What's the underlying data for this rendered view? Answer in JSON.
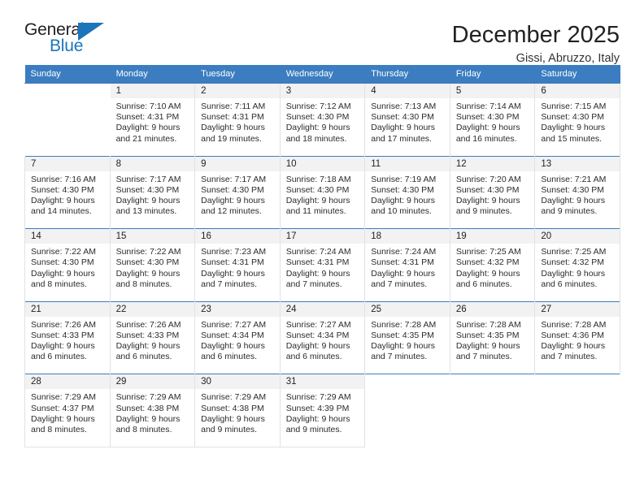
{
  "brand": {
    "name_part1": "General",
    "name_part2": "Blue",
    "accent_color": "#1b75bb"
  },
  "header": {
    "title": "December 2025",
    "subtitle": "Gissi, Abruzzo, Italy"
  },
  "calendar": {
    "header_color": "#3b7dc0",
    "weekday_headers": [
      "Sunday",
      "Monday",
      "Tuesday",
      "Wednesday",
      "Thursday",
      "Friday",
      "Saturday"
    ],
    "weeks": [
      [
        {
          "day": "",
          "sunrise": "",
          "sunset": "",
          "daylight_line1": "",
          "daylight_line2": ""
        },
        {
          "day": "1",
          "sunrise": "Sunrise: 7:10 AM",
          "sunset": "Sunset: 4:31 PM",
          "daylight_line1": "Daylight: 9 hours",
          "daylight_line2": "and 21 minutes."
        },
        {
          "day": "2",
          "sunrise": "Sunrise: 7:11 AM",
          "sunset": "Sunset: 4:31 PM",
          "daylight_line1": "Daylight: 9 hours",
          "daylight_line2": "and 19 minutes."
        },
        {
          "day": "3",
          "sunrise": "Sunrise: 7:12 AM",
          "sunset": "Sunset: 4:30 PM",
          "daylight_line1": "Daylight: 9 hours",
          "daylight_line2": "and 18 minutes."
        },
        {
          "day": "4",
          "sunrise": "Sunrise: 7:13 AM",
          "sunset": "Sunset: 4:30 PM",
          "daylight_line1": "Daylight: 9 hours",
          "daylight_line2": "and 17 minutes."
        },
        {
          "day": "5",
          "sunrise": "Sunrise: 7:14 AM",
          "sunset": "Sunset: 4:30 PM",
          "daylight_line1": "Daylight: 9 hours",
          "daylight_line2": "and 16 minutes."
        },
        {
          "day": "6",
          "sunrise": "Sunrise: 7:15 AM",
          "sunset": "Sunset: 4:30 PM",
          "daylight_line1": "Daylight: 9 hours",
          "daylight_line2": "and 15 minutes."
        }
      ],
      [
        {
          "day": "7",
          "sunrise": "Sunrise: 7:16 AM",
          "sunset": "Sunset: 4:30 PM",
          "daylight_line1": "Daylight: 9 hours",
          "daylight_line2": "and 14 minutes."
        },
        {
          "day": "8",
          "sunrise": "Sunrise: 7:17 AM",
          "sunset": "Sunset: 4:30 PM",
          "daylight_line1": "Daylight: 9 hours",
          "daylight_line2": "and 13 minutes."
        },
        {
          "day": "9",
          "sunrise": "Sunrise: 7:17 AM",
          "sunset": "Sunset: 4:30 PM",
          "daylight_line1": "Daylight: 9 hours",
          "daylight_line2": "and 12 minutes."
        },
        {
          "day": "10",
          "sunrise": "Sunrise: 7:18 AM",
          "sunset": "Sunset: 4:30 PM",
          "daylight_line1": "Daylight: 9 hours",
          "daylight_line2": "and 11 minutes."
        },
        {
          "day": "11",
          "sunrise": "Sunrise: 7:19 AM",
          "sunset": "Sunset: 4:30 PM",
          "daylight_line1": "Daylight: 9 hours",
          "daylight_line2": "and 10 minutes."
        },
        {
          "day": "12",
          "sunrise": "Sunrise: 7:20 AM",
          "sunset": "Sunset: 4:30 PM",
          "daylight_line1": "Daylight: 9 hours",
          "daylight_line2": "and 9 minutes."
        },
        {
          "day": "13",
          "sunrise": "Sunrise: 7:21 AM",
          "sunset": "Sunset: 4:30 PM",
          "daylight_line1": "Daylight: 9 hours",
          "daylight_line2": "and 9 minutes."
        }
      ],
      [
        {
          "day": "14",
          "sunrise": "Sunrise: 7:22 AM",
          "sunset": "Sunset: 4:30 PM",
          "daylight_line1": "Daylight: 9 hours",
          "daylight_line2": "and 8 minutes."
        },
        {
          "day": "15",
          "sunrise": "Sunrise: 7:22 AM",
          "sunset": "Sunset: 4:30 PM",
          "daylight_line1": "Daylight: 9 hours",
          "daylight_line2": "and 8 minutes."
        },
        {
          "day": "16",
          "sunrise": "Sunrise: 7:23 AM",
          "sunset": "Sunset: 4:31 PM",
          "daylight_line1": "Daylight: 9 hours",
          "daylight_line2": "and 7 minutes."
        },
        {
          "day": "17",
          "sunrise": "Sunrise: 7:24 AM",
          "sunset": "Sunset: 4:31 PM",
          "daylight_line1": "Daylight: 9 hours",
          "daylight_line2": "and 7 minutes."
        },
        {
          "day": "18",
          "sunrise": "Sunrise: 7:24 AM",
          "sunset": "Sunset: 4:31 PM",
          "daylight_line1": "Daylight: 9 hours",
          "daylight_line2": "and 7 minutes."
        },
        {
          "day": "19",
          "sunrise": "Sunrise: 7:25 AM",
          "sunset": "Sunset: 4:32 PM",
          "daylight_line1": "Daylight: 9 hours",
          "daylight_line2": "and 6 minutes."
        },
        {
          "day": "20",
          "sunrise": "Sunrise: 7:25 AM",
          "sunset": "Sunset: 4:32 PM",
          "daylight_line1": "Daylight: 9 hours",
          "daylight_line2": "and 6 minutes."
        }
      ],
      [
        {
          "day": "21",
          "sunrise": "Sunrise: 7:26 AM",
          "sunset": "Sunset: 4:33 PM",
          "daylight_line1": "Daylight: 9 hours",
          "daylight_line2": "and 6 minutes."
        },
        {
          "day": "22",
          "sunrise": "Sunrise: 7:26 AM",
          "sunset": "Sunset: 4:33 PM",
          "daylight_line1": "Daylight: 9 hours",
          "daylight_line2": "and 6 minutes."
        },
        {
          "day": "23",
          "sunrise": "Sunrise: 7:27 AM",
          "sunset": "Sunset: 4:34 PM",
          "daylight_line1": "Daylight: 9 hours",
          "daylight_line2": "and 6 minutes."
        },
        {
          "day": "24",
          "sunrise": "Sunrise: 7:27 AM",
          "sunset": "Sunset: 4:34 PM",
          "daylight_line1": "Daylight: 9 hours",
          "daylight_line2": "and 6 minutes."
        },
        {
          "day": "25",
          "sunrise": "Sunrise: 7:28 AM",
          "sunset": "Sunset: 4:35 PM",
          "daylight_line1": "Daylight: 9 hours",
          "daylight_line2": "and 7 minutes."
        },
        {
          "day": "26",
          "sunrise": "Sunrise: 7:28 AM",
          "sunset": "Sunset: 4:35 PM",
          "daylight_line1": "Daylight: 9 hours",
          "daylight_line2": "and 7 minutes."
        },
        {
          "day": "27",
          "sunrise": "Sunrise: 7:28 AM",
          "sunset": "Sunset: 4:36 PM",
          "daylight_line1": "Daylight: 9 hours",
          "daylight_line2": "and 7 minutes."
        }
      ],
      [
        {
          "day": "28",
          "sunrise": "Sunrise: 7:29 AM",
          "sunset": "Sunset: 4:37 PM",
          "daylight_line1": "Daylight: 9 hours",
          "daylight_line2": "and 8 minutes."
        },
        {
          "day": "29",
          "sunrise": "Sunrise: 7:29 AM",
          "sunset": "Sunset: 4:38 PM",
          "daylight_line1": "Daylight: 9 hours",
          "daylight_line2": "and 8 minutes."
        },
        {
          "day": "30",
          "sunrise": "Sunrise: 7:29 AM",
          "sunset": "Sunset: 4:38 PM",
          "daylight_line1": "Daylight: 9 hours",
          "daylight_line2": "and 9 minutes."
        },
        {
          "day": "31",
          "sunrise": "Sunrise: 7:29 AM",
          "sunset": "Sunset: 4:39 PM",
          "daylight_line1": "Daylight: 9 hours",
          "daylight_line2": "and 9 minutes."
        },
        {
          "day": "",
          "sunrise": "",
          "sunset": "",
          "daylight_line1": "",
          "daylight_line2": ""
        },
        {
          "day": "",
          "sunrise": "",
          "sunset": "",
          "daylight_line1": "",
          "daylight_line2": ""
        },
        {
          "day": "",
          "sunrise": "",
          "sunset": "",
          "daylight_line1": "",
          "daylight_line2": ""
        }
      ]
    ]
  }
}
